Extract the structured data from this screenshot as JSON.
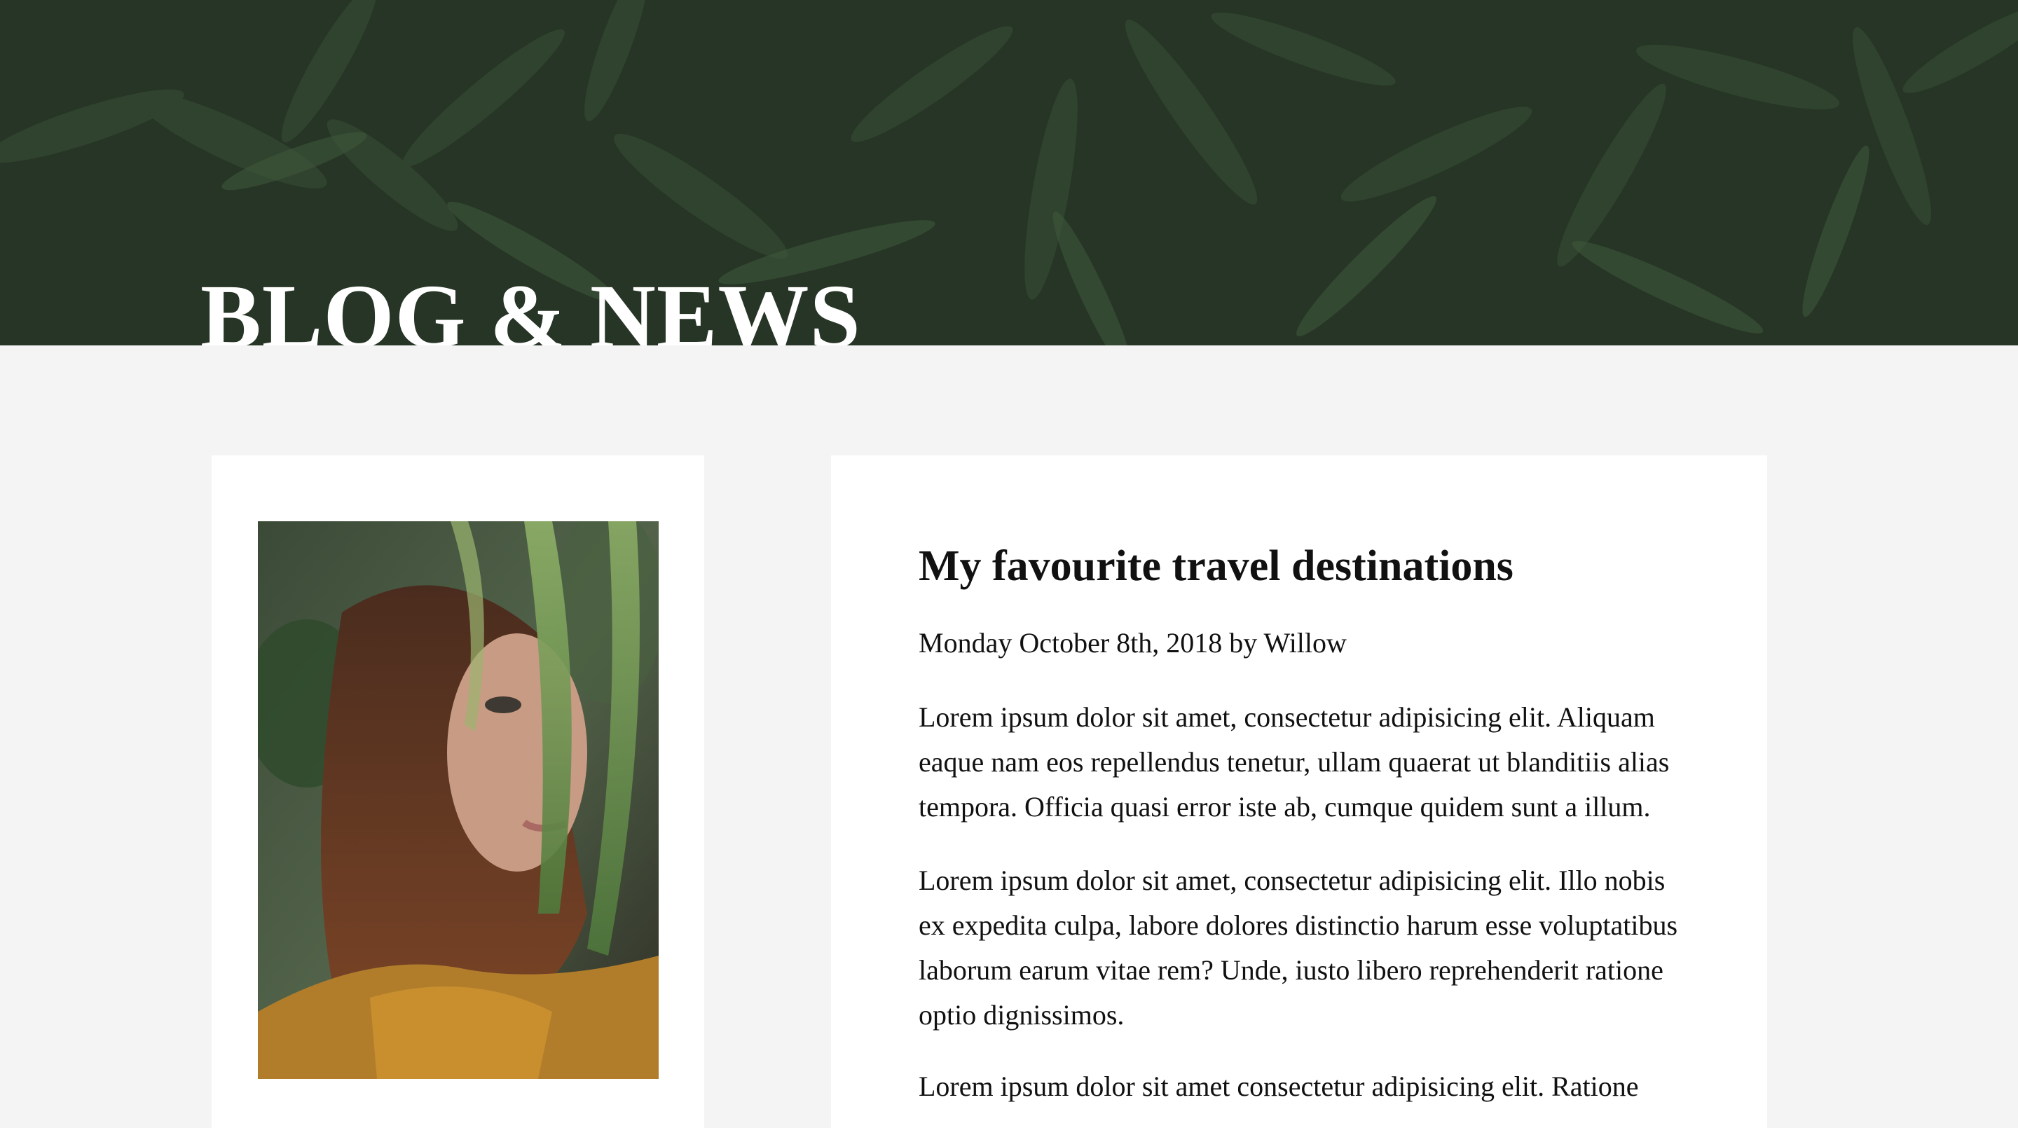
{
  "hero": {
    "title": "BLOG & NEWS"
  },
  "post": {
    "title": "My favourite travel destinations",
    "meta": "Monday October 8th, 2018 by Willow",
    "paragraphs": [
      "Lorem ipsum dolor sit amet, consectetur adipisicing elit. Aliquam eaque nam eos repellendus tenetur, ullam quaerat ut blanditiis alias tempora. Officia quasi error iste ab, cumque quidem sunt a illum.",
      "Lorem ipsum dolor sit amet, consectetur adipisicing elit. Illo nobis ex expedita culpa, labore dolores distinctio harum esse voluptatibus laborum earum vitae rem? Unde, iusto libero reprehenderit ratione optio dignissimos.",
      "Lorem ipsum dolor sit amet consectetur adipisicing elit. Ratione"
    ]
  },
  "colors": {
    "hero_bg": "#2a3a29",
    "page_bg": "#f4f4f4",
    "card_bg": "#ffffff",
    "text": "#111111"
  }
}
